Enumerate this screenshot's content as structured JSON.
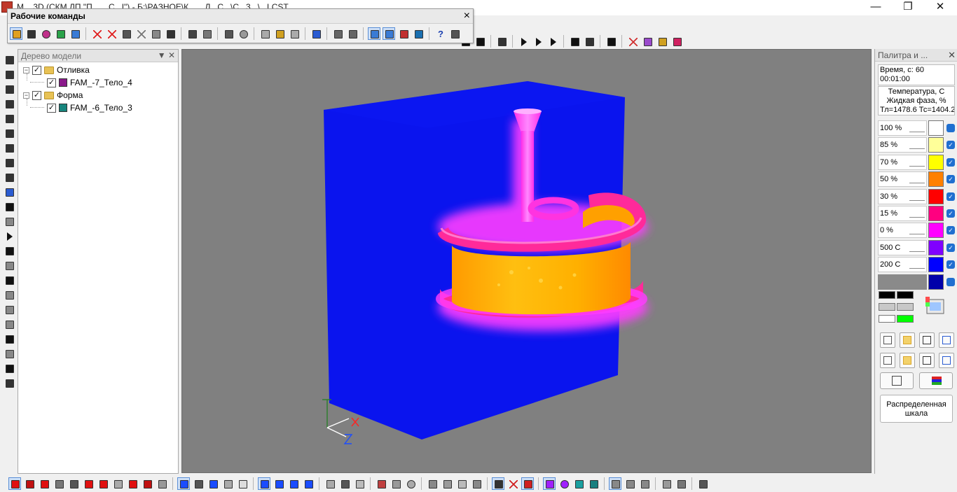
{
  "window": {
    "title": "М... 3D (СКМ ЛП \"П... ...С...I\") - Б:\\РАЗНОЕ\\К... ...Л...C...\\С...3...\\...LCST",
    "controls": [
      "minimize-icon",
      "restore-icon",
      "close-icon"
    ]
  },
  "work_commands": {
    "title": "Рабочие команды",
    "close": "×"
  },
  "model_tree": {
    "title": "Дерево модели",
    "controls": "▼ ✕",
    "items": [
      {
        "label": "Отливка",
        "level": 0,
        "checked": true,
        "expanded": true,
        "icon": "folder-icon"
      },
      {
        "label": "FAM_-7_Тело_4",
        "level": 1,
        "checked": true,
        "color": "#8b1a8b"
      },
      {
        "label": "Форма",
        "level": 0,
        "checked": true,
        "expanded": true,
        "icon": "folder-icon"
      },
      {
        "label": "FAM_-6_Тело_3",
        "level": 1,
        "checked": true,
        "color": "#17857d"
      }
    ]
  },
  "palette": {
    "title": "Палитра и ...",
    "close": "✕",
    "time_label": "Время, с: 60",
    "time_value": "00:01:00",
    "quantity_1": "Температура, С",
    "quantity_2": "Жидкая фаза, %",
    "quantity_3": "Тл=1478.6 Тс=1404.2",
    "scale": [
      {
        "label": "100 %",
        "color": "#ffffff",
        "checked": false
      },
      {
        "label": "85 %",
        "color": "#ffff99",
        "checked": true
      },
      {
        "label": "70 %",
        "color": "#ffff00",
        "checked": true
      },
      {
        "label": "50 %",
        "color": "#ff8000",
        "checked": true
      },
      {
        "label": "30 %",
        "color": "#ff0000",
        "checked": true
      },
      {
        "label": "15 %",
        "color": "#ff0080",
        "checked": true
      },
      {
        "label": "0 %",
        "color": "#ff00ff",
        "checked": true
      },
      {
        "label": "500 С",
        "color": "#8000ff",
        "checked": true
      },
      {
        "label": "200 С",
        "color": "#0000ff",
        "checked": true
      },
      {
        "label": "",
        "color": "#0000aa",
        "checked": false
      }
    ],
    "distributed_scale": "Распределенная шкала"
  },
  "colors": {
    "mold": "#0a14ee",
    "sprue": "#ff3cff",
    "ring": "#ff2a9a",
    "core_hot": "#ffb000",
    "viewport_bg": "#808080"
  }
}
